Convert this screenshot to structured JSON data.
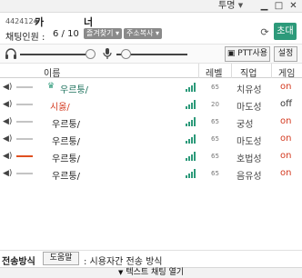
{
  "window": {
    "opacity_label": "투명",
    "opacity_dropdown_icon": "chevron-down-icon",
    "minimize_icon": "minimize-icon",
    "maximize_icon": "maximize-icon",
    "close_icon": "close-icon"
  },
  "room": {
    "id": "4424124",
    "name_part1": "카",
    "name_part2": "너",
    "chatters_label": "채팅인원 :",
    "chatters_count": "6 / 10",
    "favorite_button": "즐겨찾기 ▾",
    "copy_address_button": "주소복사 ▾",
    "refresh_icon": "refresh-icon",
    "invite_button": "초대"
  },
  "audio": {
    "headphone_icon": "headphone-icon",
    "mic_icon": "mic-icon",
    "output_volume": 1.0,
    "mic_volume": 0.05,
    "ptt_button": "PTT사용",
    "settings_button": "설정"
  },
  "list": {
    "headers": {
      "name": "이름",
      "level": "레벨",
      "job": "직업",
      "game": "게임"
    },
    "rows": [
      {
        "name": "우르퉁/",
        "host": true,
        "name_color": "#1a6f5a",
        "level": "65",
        "job": "치유성",
        "game": "on",
        "speaking": false
      },
      {
        "name": "시옳/",
        "host": false,
        "name_color": "#d43a20",
        "level": "20",
        "job": "마도성",
        "game": "off",
        "speaking": false
      },
      {
        "name": "우르퉁/",
        "host": false,
        "name_color": "#222222",
        "level": "65",
        "job": "궁성",
        "game": "on",
        "speaking": false
      },
      {
        "name": "우르퉁/",
        "host": false,
        "name_color": "#222222",
        "level": "65",
        "job": "마도성",
        "game": "on",
        "speaking": false
      },
      {
        "name": "우르퉁/",
        "host": false,
        "name_color": "#222222",
        "level": "65",
        "job": "호법성",
        "game": "on",
        "speaking": true
      },
      {
        "name": "우르퉁/",
        "host": false,
        "name_color": "#222222",
        "level": "65",
        "job": "음유성",
        "game": "on",
        "speaking": false
      }
    ]
  },
  "bottom": {
    "send_method_label": "전송방식",
    "help_button": "도움말",
    "send_method_desc": ": 시용자간 전송 방식",
    "expand_label": "텍스트 채팅 열기",
    "expand_icon": "caret-down-icon"
  },
  "colors": {
    "accent": "#2d9a7a",
    "game_on": "#d43a20",
    "speaking": "#e05020"
  }
}
